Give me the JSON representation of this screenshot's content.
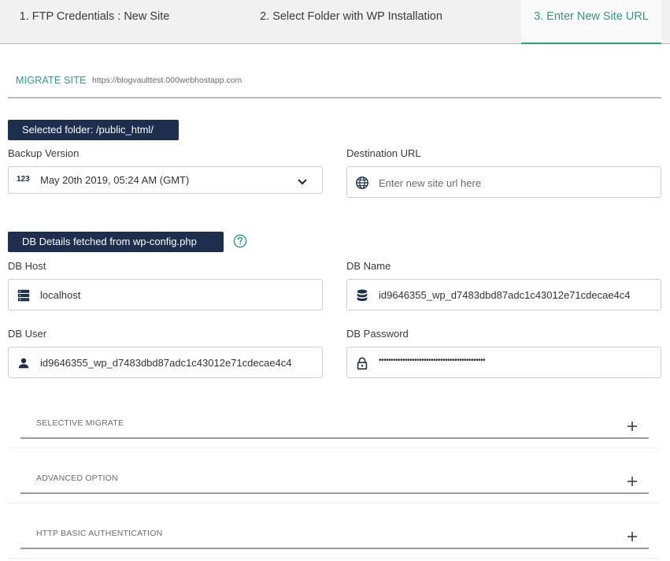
{
  "tabs": [
    {
      "label": "1. FTP Credentials : New Site"
    },
    {
      "label": "2. Select Folder with WP Installation"
    },
    {
      "label": "3. Enter New Site URL"
    }
  ],
  "migrate": {
    "label": "MIGRATE SITE",
    "url": "https://blogvaulttest.000webhostapp.com"
  },
  "selected_folder": "Selected folder: /public_html/",
  "backup_version": {
    "label": "Backup Version",
    "value": "May 20th 2019, 05:24 AM (GMT)",
    "icon_text": "123"
  },
  "destination_url": {
    "label": "Destination URL",
    "placeholder": "Enter new site url here"
  },
  "db_details_label": "DB Details fetched from wp-config.php",
  "db_host": {
    "label": "DB Host",
    "value": "localhost"
  },
  "db_name": {
    "label": "DB Name",
    "value": "id9646355_wp_d7483dbd87adc1c43012e71cdecae4c4"
  },
  "db_user": {
    "label": "DB User",
    "value": "id9646355_wp_d7483dbd87adc1c43012e71cdecae4c4"
  },
  "db_password": {
    "label": "DB Password",
    "value": "•••••••••••••••••••••••••••••••••••••••••••••"
  },
  "accordions": [
    {
      "label": "SELECTIVE MIGRATE"
    },
    {
      "label": "ADVANCED OPTION"
    },
    {
      "label": "HTTP BASIC AUTHENTICATION"
    }
  ],
  "colors": {
    "accent": "#2e9d7e",
    "pill_bg": "#1e2e4f",
    "icon": "#1e2e4f"
  },
  "icons": {
    "backup": "numbers-icon",
    "destination": "globe-icon",
    "help": "help-circle-icon",
    "host": "server-icon",
    "name": "database-icon",
    "user": "person-icon",
    "password": "lock-icon",
    "dropdown": "chevron-down-icon",
    "expand": "plus-icon"
  }
}
